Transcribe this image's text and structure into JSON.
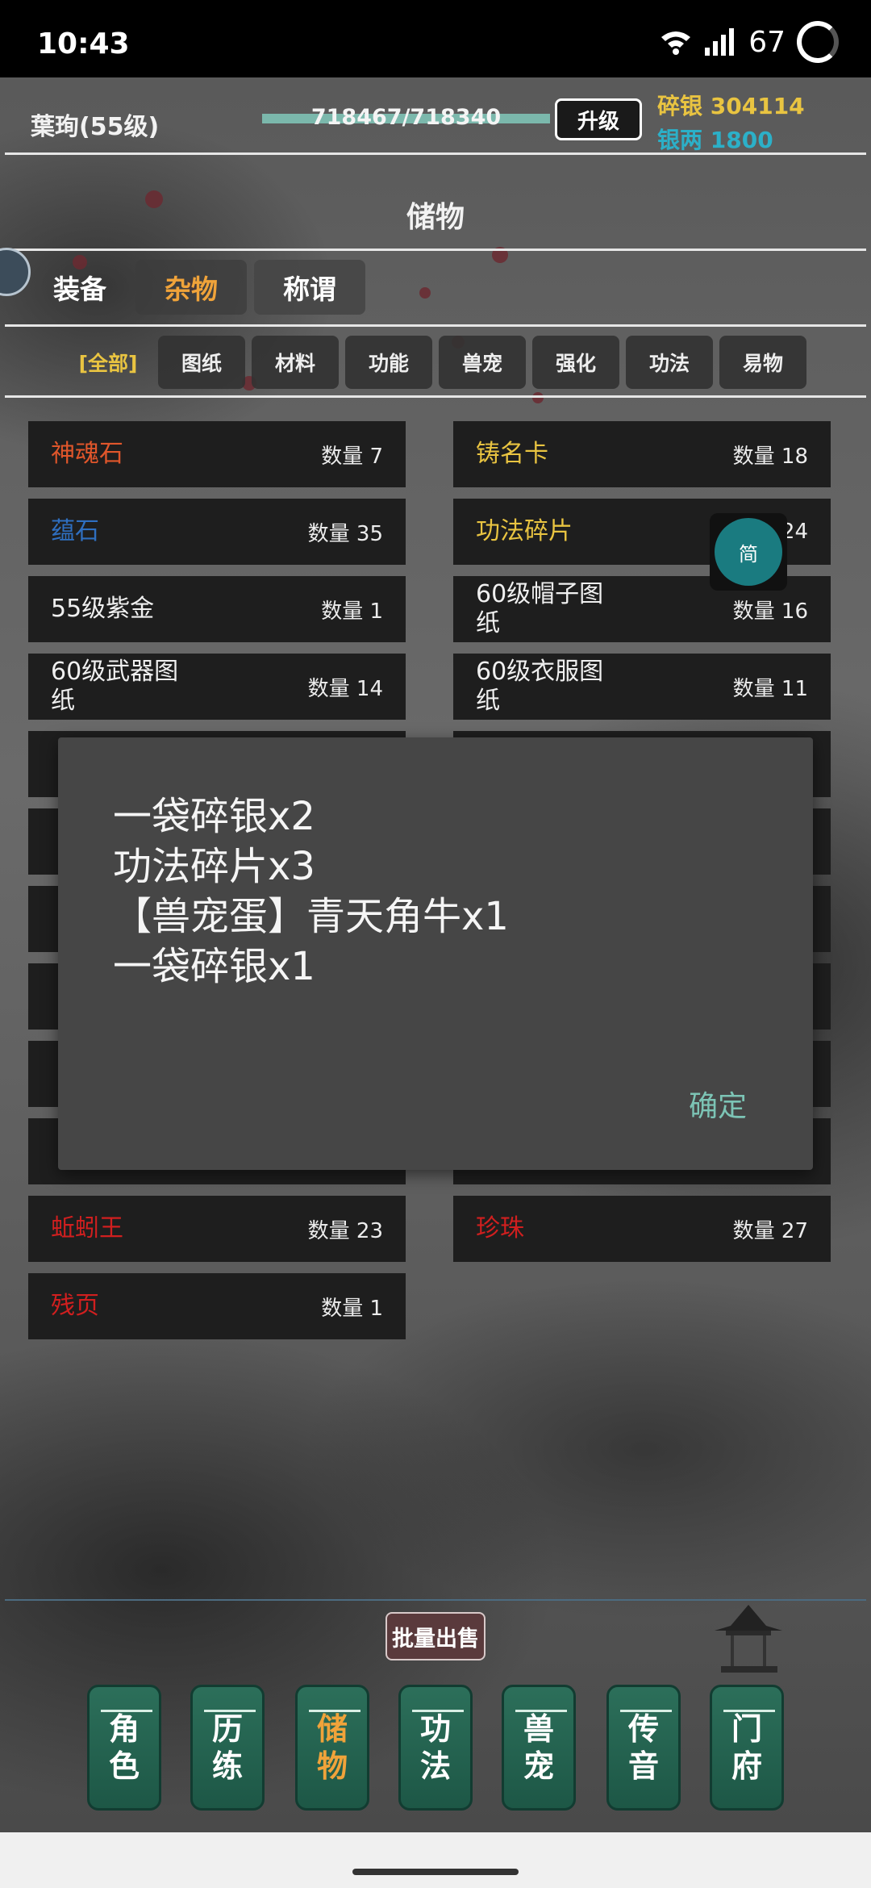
{
  "status_bar": {
    "time": "10:43",
    "battery": "67"
  },
  "header": {
    "player_name": "葉珣(55级)",
    "exp_text": "718467/718340",
    "exp_fraction": 1.0,
    "upgrade_label": "升级",
    "currency": [
      {
        "label": "碎银",
        "value": "304114",
        "color": "#e9c441"
      },
      {
        "label": "银两",
        "value": "1800",
        "color": "#2cb0c8"
      }
    ]
  },
  "page_title": "储物",
  "main_tabs": [
    "装备",
    "杂物",
    "称谓"
  ],
  "sub_tabs": [
    "[全部]",
    "图纸",
    "材料",
    "功能",
    "兽宠",
    "强化",
    "功法",
    "易物"
  ],
  "items_left": [
    {
      "name": "神魂石",
      "qty": "数量 7",
      "color": "#e0562b"
    },
    {
      "name": "蕴石",
      "qty": "数量 35",
      "color": "#2f6fc0"
    },
    {
      "name": "55级紫金",
      "qty": "数量 1",
      "color": "#f0f0f0"
    },
    {
      "name": "60级武器图纸",
      "qty": "数量 14",
      "color": "#f0f0f0"
    },
    {
      "name": "蚯蚓王",
      "qty": "数量 23",
      "color": "#d11f1f"
    },
    {
      "name": "残页",
      "qty": "数量 1",
      "color": "#d11f1f"
    }
  ],
  "items_right": [
    {
      "name": "铸名卡",
      "qty": "数量 18",
      "color": "#e9c441"
    },
    {
      "name": "功法碎片",
      "qty": "24",
      "color": "#e9c441"
    },
    {
      "name": "60级帽子图纸",
      "qty": "数量 16",
      "color": "#f0f0f0"
    },
    {
      "name": "60级衣服图纸",
      "qty": "数量 11",
      "color": "#f0f0f0"
    },
    {
      "name": "珍珠",
      "qty": "数量 27",
      "color": "#d11f1f"
    }
  ],
  "float_widget": "简",
  "dialog": {
    "lines": [
      "一袋碎银x2",
      "功法碎片x3",
      "【兽宠蛋】青天角牛x1",
      "一袋碎银x1"
    ],
    "confirm_label": "确定"
  },
  "batch_sell_label": "批量出售",
  "bottom_nav": [
    {
      "label": [
        "角",
        "色"
      ]
    },
    {
      "label": [
        "历",
        "练"
      ]
    },
    {
      "label": [
        "储",
        "物"
      ]
    },
    {
      "label": [
        "功",
        "法"
      ]
    },
    {
      "label": [
        "兽",
        "宠"
      ]
    },
    {
      "label": [
        "传",
        "音"
      ]
    },
    {
      "label": [
        "门",
        "府"
      ]
    }
  ]
}
